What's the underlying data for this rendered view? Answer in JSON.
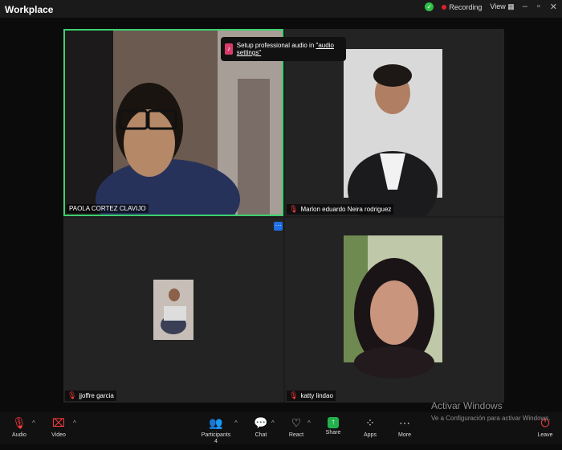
{
  "app": {
    "title": "Workplace"
  },
  "topbar": {
    "recording": "Recording",
    "view": "View"
  },
  "notification": {
    "text": "Setup professional audio in ",
    "link": "\"audio settings\""
  },
  "participants": [
    {
      "name": "PAOLA CORTEZ CLAVIJO",
      "muted": false
    },
    {
      "name": "Marlon eduardo Neira rodriguez",
      "muted": true
    },
    {
      "name": "jjoffre garcia",
      "muted": true
    },
    {
      "name": "katty lindao",
      "muted": true
    }
  ],
  "toolbar": {
    "audio": "Audio",
    "video": "Video",
    "participants": "Participants",
    "participants_count": "4",
    "chat": "Chat",
    "react": "React",
    "share": "Share",
    "apps": "Apps",
    "more": "More",
    "leave": "Leave"
  },
  "watermark": {
    "line1": "Activar Windows",
    "line2": "Ve a Configuración para activar Windows."
  },
  "colors": {
    "active_speaker": "#3dd06e",
    "share": "#22b24c",
    "muted": "#ff3b3b",
    "more_button": "#1f6fe5"
  }
}
